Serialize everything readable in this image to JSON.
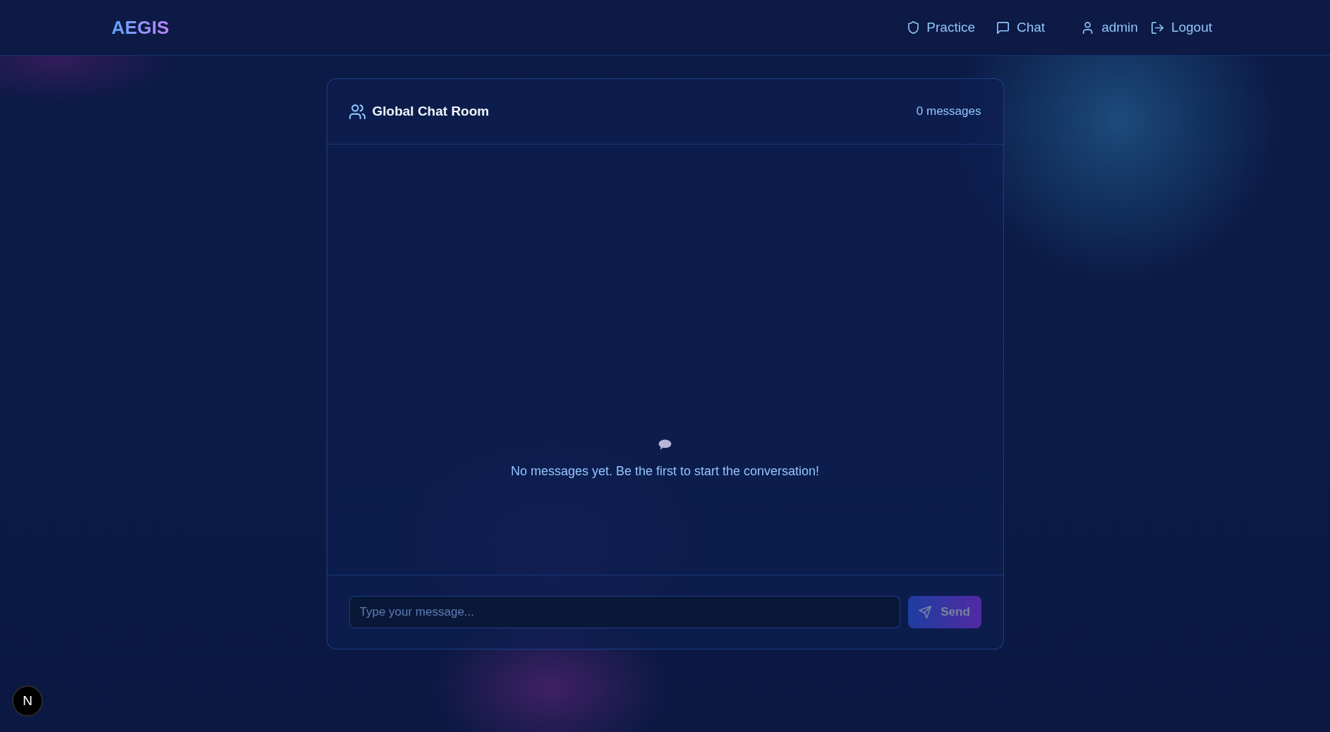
{
  "header": {
    "logo": "AEGIS",
    "nav": [
      {
        "label": "Practice"
      },
      {
        "label": "Chat"
      }
    ],
    "user": {
      "name": "admin"
    },
    "logout": {
      "label": "Logout"
    }
  },
  "chat": {
    "title": "Global Chat Room",
    "message_count": "0 messages",
    "empty_text": "No messages yet. Be the first to start the conversation!",
    "input": {
      "placeholder": "Type your message..."
    },
    "send_button": {
      "label": "Send",
      "disabled": true
    }
  },
  "dev_badge": {
    "label": "N"
  }
}
